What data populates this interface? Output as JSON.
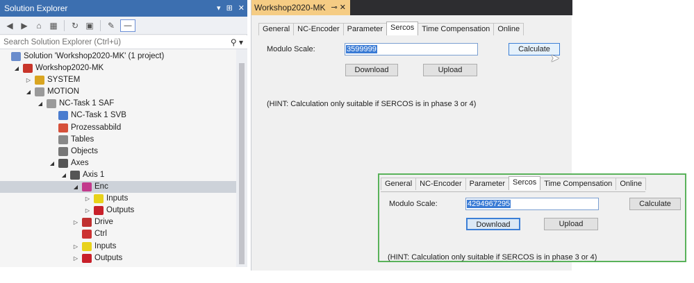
{
  "solution_explorer": {
    "title": "Solution Explorer",
    "title_controls": [
      "▾",
      "⊞",
      "✕"
    ],
    "search_placeholder": "Search Solution Explorer (Ctrl+ü)",
    "tree": [
      {
        "label": "Solution 'Workshop2020-MK' (1 project)",
        "icon": "solution-icon",
        "depth": 0,
        "expander": ""
      },
      {
        "label": "Workshop2020-MK",
        "icon": "project-icon",
        "depth": 1,
        "expander": "◢"
      },
      {
        "label": "SYSTEM",
        "icon": "system-icon",
        "depth": 2,
        "expander": "▷"
      },
      {
        "label": "MOTION",
        "icon": "motion-icon",
        "depth": 2,
        "expander": "◢"
      },
      {
        "label": "NC-Task 1 SAF",
        "icon": "nc-task-icon",
        "depth": 3,
        "expander": "◢"
      },
      {
        "label": "NC-Task 1 SVB",
        "icon": "nc-svb-icon",
        "depth": 4,
        "expander": ""
      },
      {
        "label": "Prozessabbild",
        "icon": "process-image-icon",
        "depth": 4,
        "expander": ""
      },
      {
        "label": "Tables",
        "icon": "table-icon",
        "depth": 4,
        "expander": ""
      },
      {
        "label": "Objects",
        "icon": "objects-icon",
        "depth": 4,
        "expander": ""
      },
      {
        "label": "Axes",
        "icon": "axes-icon",
        "depth": 4,
        "expander": "◢"
      },
      {
        "label": "Axis 1",
        "icon": "axis-icon",
        "depth": 5,
        "expander": "◢"
      },
      {
        "label": "Enc",
        "icon": "encoder-icon",
        "depth": 6,
        "expander": "◢",
        "selected": true
      },
      {
        "label": "Inputs",
        "icon": "inputs-icon",
        "depth": 7,
        "expander": "▷"
      },
      {
        "label": "Outputs",
        "icon": "outputs-icon",
        "depth": 7,
        "expander": "▷"
      },
      {
        "label": "Drive",
        "icon": "drive-icon",
        "depth": 6,
        "expander": "▷"
      },
      {
        "label": "Ctrl",
        "icon": "ctrl-icon",
        "depth": 6,
        "expander": ""
      },
      {
        "label": "Inputs",
        "icon": "inputs-icon",
        "depth": 6,
        "expander": "▷"
      },
      {
        "label": "Outputs",
        "icon": "outputs-icon",
        "depth": 6,
        "expander": "▷"
      }
    ]
  },
  "workshop": {
    "doc_tab": "Workshop2020-MK",
    "doc_tab_controls": "⊸ ✕",
    "tabs": [
      "General",
      "NC-Encoder",
      "Parameter",
      "Sercos",
      "Time Compensation",
      "Online"
    ],
    "active_tab": "Sercos",
    "modulo_label": "Modulo Scale:",
    "modulo_value": "3599999",
    "calculate": "Calculate",
    "download": "Download",
    "upload": "Upload",
    "hint": "(HINT: Calculation only suitable if SERCOS is in phase 3 or 4)"
  },
  "zoom": {
    "tabs": [
      "General",
      "NC-Encoder",
      "Parameter",
      "Sercos",
      "Time Compensation",
      "Online"
    ],
    "active_tab": "Sercos",
    "modulo_label": "Modulo Scale:",
    "modulo_value": "4294967295",
    "calculate": "Calculate",
    "download": "Download",
    "upload": "Upload",
    "hint": "(HINT: Calculation only suitable if SERCOS is in phase 3 or 4)",
    "border_color": "#59b25a"
  }
}
